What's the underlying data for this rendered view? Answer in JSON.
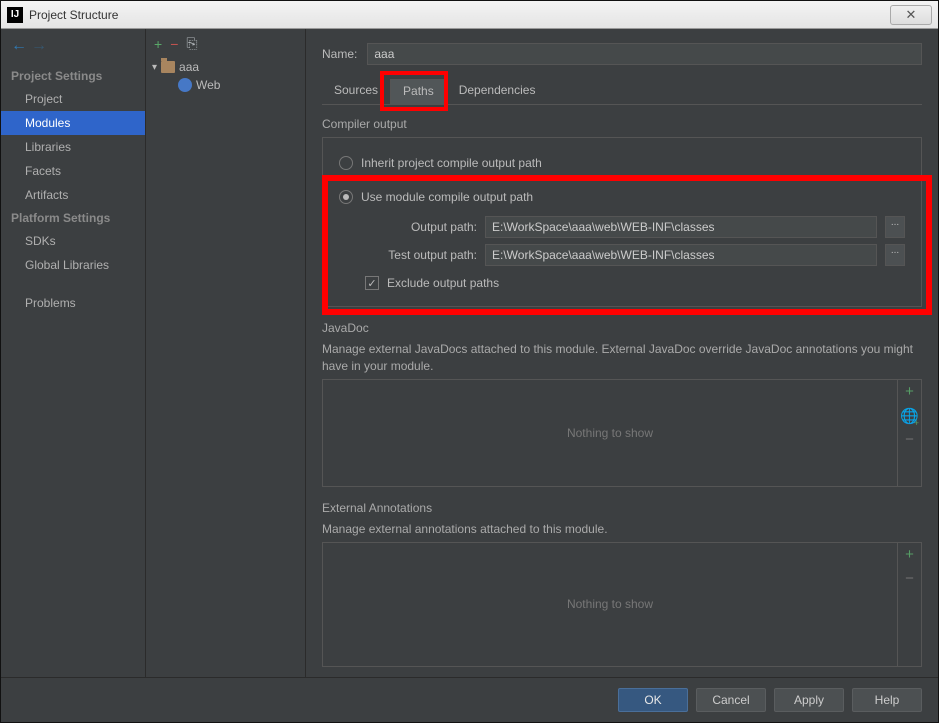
{
  "titlebar": {
    "title": "Project Structure",
    "close_glyph": "✕",
    "icon_text": "IJ"
  },
  "nav": {
    "back_glyph": "←",
    "forward_glyph": "→"
  },
  "sidebar": {
    "groups": [
      {
        "heading": "Project Settings",
        "items": [
          "Project",
          "Modules",
          "Libraries",
          "Facets",
          "Artifacts"
        ],
        "selected": "Modules"
      },
      {
        "heading": "Platform Settings",
        "items": [
          "SDKs",
          "Global Libraries"
        ]
      }
    ],
    "problems": "Problems"
  },
  "tree": {
    "toolbar": {
      "plus": "+",
      "minus": "−",
      "copy": "⎘"
    },
    "module_name": "aaa",
    "child_name": "Web"
  },
  "main": {
    "name_label": "Name:",
    "name_value": "aaa",
    "tabs": {
      "sources": "Sources",
      "paths": "Paths",
      "deps": "Dependencies",
      "active": "Paths"
    },
    "compiler": {
      "heading": "Compiler output",
      "radio_inherit": "Inherit project compile output path",
      "radio_module": "Use module compile output path",
      "output_label": "Output path:",
      "output_value": "E:\\WorkSpace\\aaa\\web\\WEB-INF\\classes",
      "test_label": "Test output path:",
      "test_value": "E:\\WorkSpace\\aaa\\web\\WEB-INF\\classes",
      "exclude_label": "Exclude output paths",
      "exclude_checked": "✓",
      "browse": "..."
    },
    "javadoc": {
      "heading": "JavaDoc",
      "desc": "Manage external JavaDocs attached to this module. External JavaDoc override JavaDoc annotations you might have in your module.",
      "empty": "Nothing to show"
    },
    "extann": {
      "heading": "External Annotations",
      "desc": "Manage external annotations attached to this module.",
      "empty": "Nothing to show"
    }
  },
  "footer": {
    "ok": "OK",
    "cancel": "Cancel",
    "apply": "Apply",
    "help": "Help"
  },
  "glyphs": {
    "plus": "+",
    "minus": "−",
    "globe": "🌐"
  }
}
